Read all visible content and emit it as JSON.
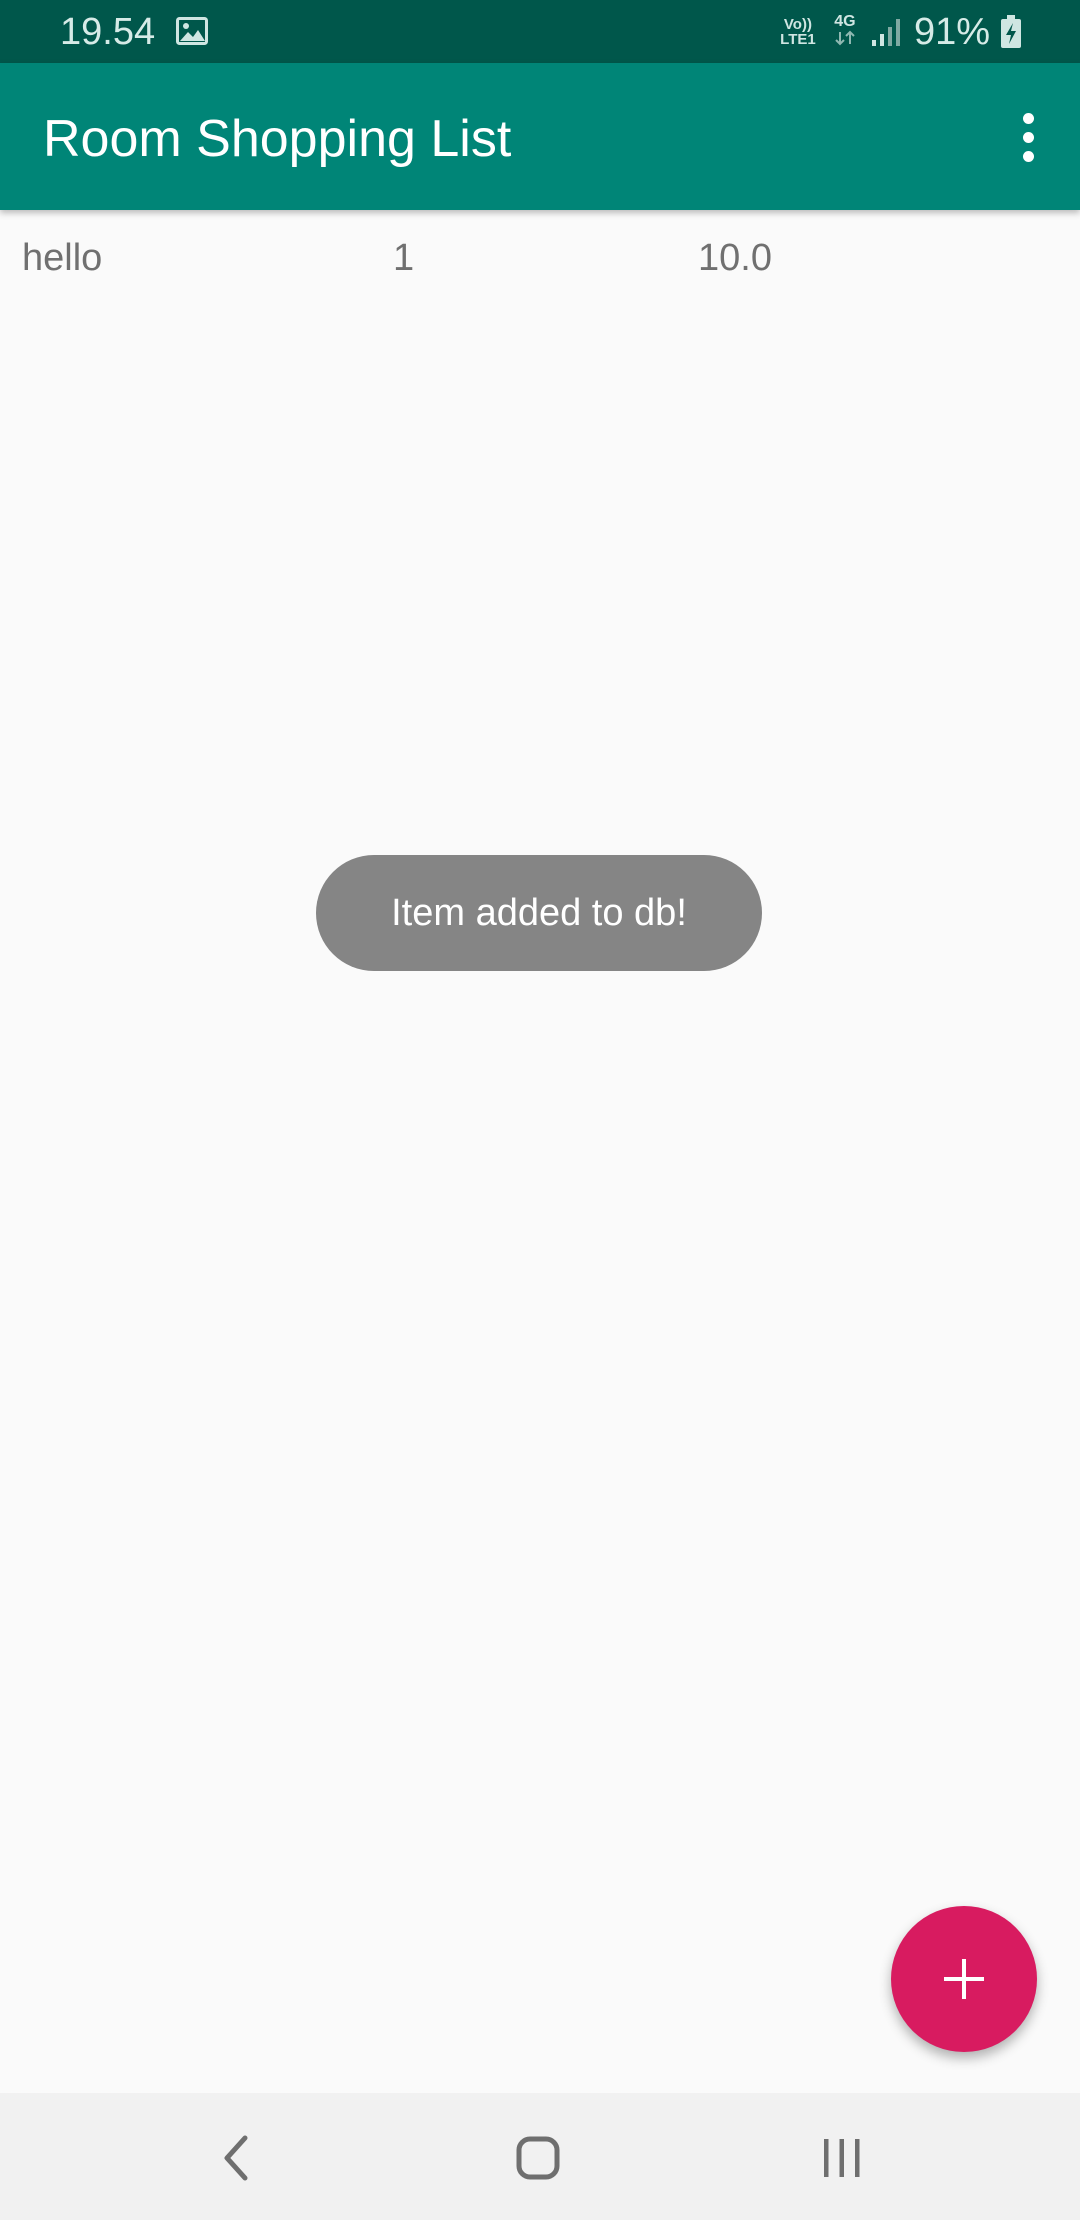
{
  "status_bar": {
    "time": "19.54",
    "image_icon": "image-icon",
    "volte_line1": "Vo))",
    "volte_line2": "LTE1",
    "network": "4G",
    "battery_percent": "91%"
  },
  "app_bar": {
    "title": "Room Shopping List",
    "menu_icon": "more-vert-icon"
  },
  "list": {
    "items": [
      {
        "name": "hello",
        "quantity": "1",
        "price": "10.0"
      }
    ]
  },
  "toast": {
    "message": "Item added to db!"
  },
  "fab": {
    "icon": "plus-icon"
  },
  "nav_bar": {
    "back_icon": "back-chevron-icon",
    "home_icon": "home-icon",
    "recents_icon": "recents-icon"
  },
  "colors": {
    "status_bar": "#00574b",
    "primary": "#008577",
    "accent": "#d81b60",
    "background": "#fafafa",
    "toast": "#858585"
  }
}
